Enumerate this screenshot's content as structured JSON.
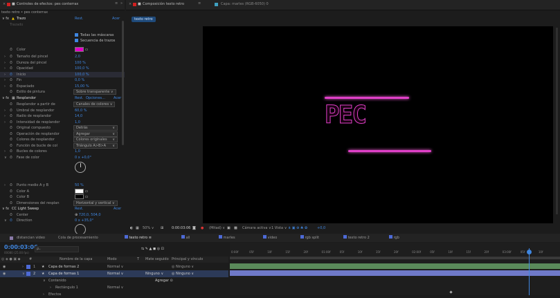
{
  "effects_panel": {
    "tab_label": "Controles de efectos: pes conterrax",
    "subtitle": "texto retro • pes conterrax",
    "effect1": {
      "name": "Trazo",
      "reset": "Rest.",
      "about": "Acer"
    },
    "checkbox1": "Todas las máscaras",
    "checkbox2": "Secuencia de trazos",
    "params": [
      {
        "label": "Color",
        "value": ""
      },
      {
        "label": "Tamaño del pincel",
        "value": "2,0"
      },
      {
        "label": "Dureza del pincel",
        "value": "100 %"
      },
      {
        "label": "Opacidad",
        "value": "100,0 %"
      },
      {
        "label": "Inicio",
        "value": "100,0 %"
      },
      {
        "label": "Fin",
        "value": "0,0 %"
      },
      {
        "label": "Espaciado",
        "value": "15,00 %"
      },
      {
        "label": "Estilo de pintura",
        "value": "Sobre transparente"
      }
    ],
    "effect2": {
      "name": "Resplandor",
      "reset": "Rest.",
      "options": "Opciones...",
      "about": "Acer"
    },
    "glow_params": [
      {
        "label": "Resplandor a partir de",
        "value": "Canales de colores"
      },
      {
        "label": "Umbral de resplandor",
        "value": "60,0 %"
      },
      {
        "label": "Radio de resplandor",
        "value": "14,0"
      },
      {
        "label": "Intensidad de resplandor",
        "value": "1,0"
      },
      {
        "label": "Original compuesto",
        "value": "Detrás"
      },
      {
        "label": "Operación de resplandor",
        "value": "Agregar"
      },
      {
        "label": "Colores de resplandor",
        "value": "Colores originales"
      },
      {
        "label": "Función de bucle de col",
        "value": "Triángulo A>B>A"
      },
      {
        "label": "Bucles de colores",
        "value": "1,0"
      },
      {
        "label": "Fase de color",
        "value": "0 x +0,0°"
      }
    ],
    "glow_params2": [
      {
        "label": "Punto medio A y B",
        "value": "50 %"
      },
      {
        "label": "Color A",
        "value": ""
      },
      {
        "label": "Color B",
        "value": ""
      },
      {
        "label": "Dimensiones del resplan",
        "value": "Horizontal y vertical"
      }
    ],
    "effect3": {
      "name": "CC Light Sweep",
      "reset": "Rest.",
      "about": "Acer"
    },
    "sweep_params": [
      {
        "label": "Center",
        "value": "720,0, 504,0"
      },
      {
        "label": "Direction",
        "value": "0 x +35,0°"
      }
    ],
    "colors": {
      "magenta": "#e400c8",
      "white": "#ffffff",
      "black": "#000000"
    }
  },
  "comp_panel": {
    "tab_label": "Composición texto retro",
    "sub_tab": "texto retro",
    "layer_tab": "Capa: marles (RGB-6050) 0",
    "neon_text": "PEC",
    "bar_color": "#e040c8",
    "toolbar": {
      "zoom": "50%",
      "timecode": "0:00:03:06",
      "resolution": "(Mitad)",
      "camera": "Cámara activa",
      "view": "1 Vista",
      "offset": "+0,0"
    }
  },
  "timeline": {
    "tabs": [
      "distancian video",
      "Cola de procesamiento",
      "texto retro",
      "all",
      "marles",
      "video",
      "rgb split",
      "texto retro 2",
      "rgb"
    ],
    "timecode": "0:00:03:06",
    "frames": "00080 (25.00 fps)",
    "search_placeholder": "ρ₊",
    "columns": [
      "#",
      "Nombre de la capa",
      "Modo",
      "T",
      "Mate seguido",
      "Principal y vínculo"
    ],
    "layers": [
      {
        "num": "1",
        "name": "Capa de formas 2",
        "mode": "Normal",
        "matte": "",
        "parent": "Ninguno"
      },
      {
        "num": "2",
        "name": "Capa de formas 1",
        "mode": "Normal",
        "matte": "Ninguno",
        "parent": "Ninguno"
      }
    ],
    "sub_rows": [
      {
        "label": "Contenido",
        "value": "Agregar"
      },
      {
        "label": "Rectángulo 1",
        "value": "Normal"
      },
      {
        "label": "Efectos",
        "value": ""
      }
    ],
    "ruler": [
      "0:00f",
      "05f",
      "10f",
      "15f",
      "20f",
      "01:00f",
      "05f",
      "10f",
      "15f",
      "20f",
      "02:00f",
      "05f",
      "10f",
      "15f",
      "20f",
      "03:00f",
      "05f",
      "10f"
    ],
    "colors": {
      "accent": "#3f86e0",
      "label_blue": "#4d6ad6",
      "label_yellow": "#e8c000",
      "track_green": "#5a8a5a"
    }
  }
}
